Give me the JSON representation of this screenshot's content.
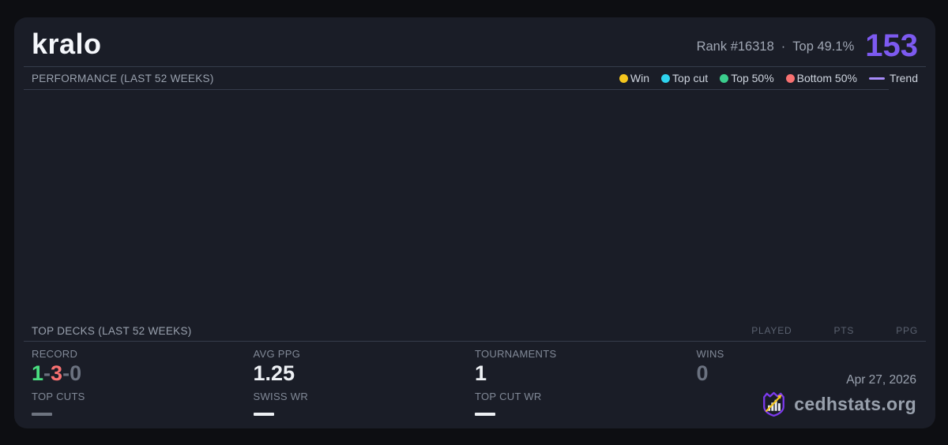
{
  "page": {
    "background": "#0d0e12",
    "card_background": "#1a1d27",
    "accent_purple": "#7d5af0"
  },
  "header": {
    "player_name": "kralo",
    "rank": "Rank #16318",
    "dot_separator": "·",
    "top_percent": "Top 49.1%",
    "points": "153"
  },
  "performance": {
    "title": "PERFORMANCE (LAST 52 WEEKS)",
    "legend": [
      {
        "label": "Win",
        "color": "#f4c51d",
        "marker": "dot"
      },
      {
        "label": "Top cut",
        "color": "#2ed3ee",
        "marker": "dot"
      },
      {
        "label": "Top 50%",
        "color": "#3bce8d",
        "marker": "dot"
      },
      {
        "label": "Bottom 50%",
        "color": "#f87171",
        "marker": "dot"
      },
      {
        "label": "Trend",
        "color": "#a78bfa",
        "marker": "line"
      }
    ]
  },
  "chart_data": {
    "type": "scatter",
    "series": [],
    "title": "PERFORMANCE (LAST 52 WEEKS)",
    "grid": false
  },
  "top_decks": {
    "title": "TOP DECKS (LAST 52 WEEKS)",
    "columns": [
      "PLAYED",
      "PTS",
      "PPG"
    ],
    "rows": []
  },
  "stats": {
    "record": {
      "label": "RECORD",
      "wins": "1",
      "losses": "3",
      "draws": "0",
      "separator": "-",
      "win_color": "#4ade80",
      "loss_color": "#f87171",
      "draw_color": "#6b7280"
    },
    "avg_ppg": {
      "label": "AVG PPG",
      "value": "1.25"
    },
    "tournaments": {
      "label": "TOURNAMENTS",
      "value": "1"
    },
    "wins": {
      "label": "WINS",
      "value": "0"
    },
    "top_cuts": {
      "label": "TOP CUTS",
      "value": "—"
    },
    "swiss_wr": {
      "label": "SWISS WR",
      "value": "—"
    },
    "top_cut_wr": {
      "label": "TOP CUT WR",
      "value": "—"
    }
  },
  "footer": {
    "date": "Apr 27, 2026",
    "brand": "cedhstats.org"
  }
}
